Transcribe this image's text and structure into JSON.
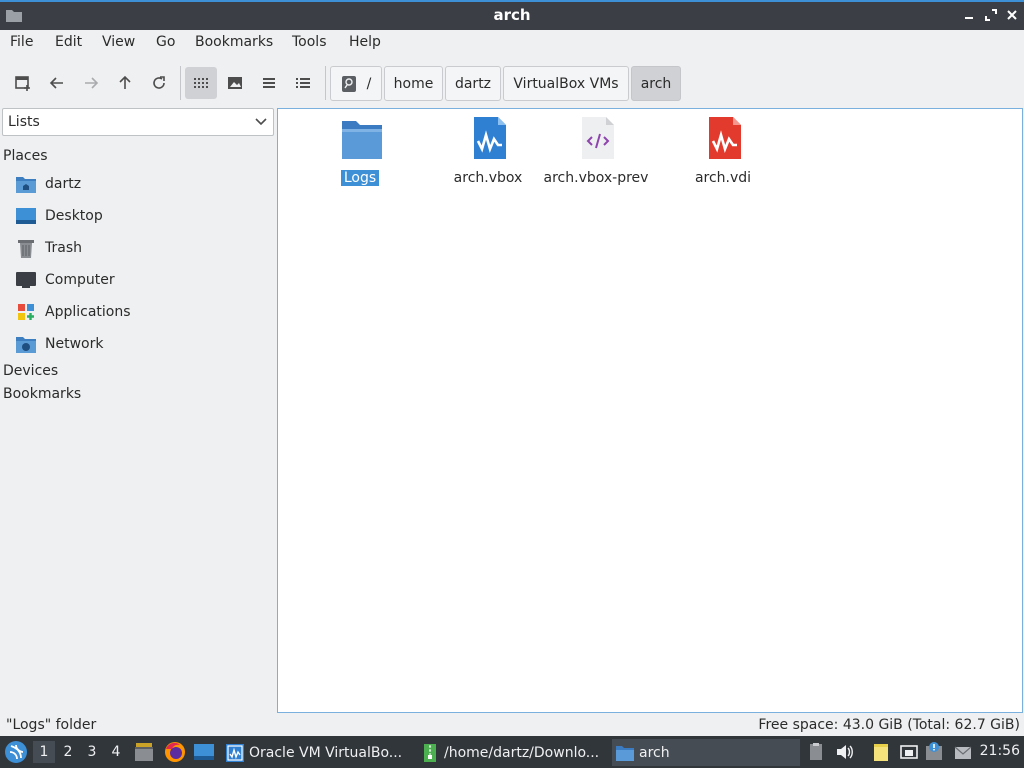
{
  "window": {
    "title": "arch"
  },
  "menu": [
    "File",
    "Edit",
    "View",
    "Go",
    "Bookmarks",
    "Tools",
    "Help"
  ],
  "toolbar": {
    "icons": [
      "new-tab-icon",
      "back-icon",
      "forward-icon",
      "up-icon",
      "reload-icon",
      "icon-view-icon",
      "thumbnail-view-icon",
      "compact-view-icon",
      "detailed-list-view-icon"
    ],
    "active_view": "icon-view"
  },
  "breadcrumb": {
    "root": "/",
    "parts": [
      "home",
      "dartz",
      "VirtualBox VMs",
      "arch"
    ]
  },
  "side": {
    "selector": "Lists",
    "places_heading": "Places",
    "places": [
      "dartz",
      "Desktop",
      "Trash",
      "Computer",
      "Applications",
      "Network"
    ],
    "devices_heading": "Devices",
    "bookmarks_heading": "Bookmarks"
  },
  "files": [
    {
      "name": "Logs",
      "icon": "folder-icon",
      "selected": true
    },
    {
      "name": "arch.vbox",
      "icon": "virtualbox-file-icon",
      "selected": false
    },
    {
      "name": "arch.vbox-prev",
      "icon": "xml-file-icon",
      "selected": false
    },
    {
      "name": "arch.vdi",
      "icon": "disk-image-file-icon",
      "selected": false
    }
  ],
  "status": {
    "left": "\"Logs\" folder",
    "right": "Free space: 43.0 GiB (Total: 62.7 GiB)"
  },
  "taskbar": {
    "workspaces": [
      "1",
      "2",
      "3",
      "4"
    ],
    "active_workspace": "1",
    "tasks": [
      "Oracle VM VirtualBo...",
      "/home/dartz/Downlo...",
      "arch"
    ],
    "active_task": "arch",
    "clock": "21:56"
  },
  "colors": {
    "accent": "#3d8fd6",
    "titlebar": "#3b3f45",
    "taskbar": "#31363b"
  }
}
